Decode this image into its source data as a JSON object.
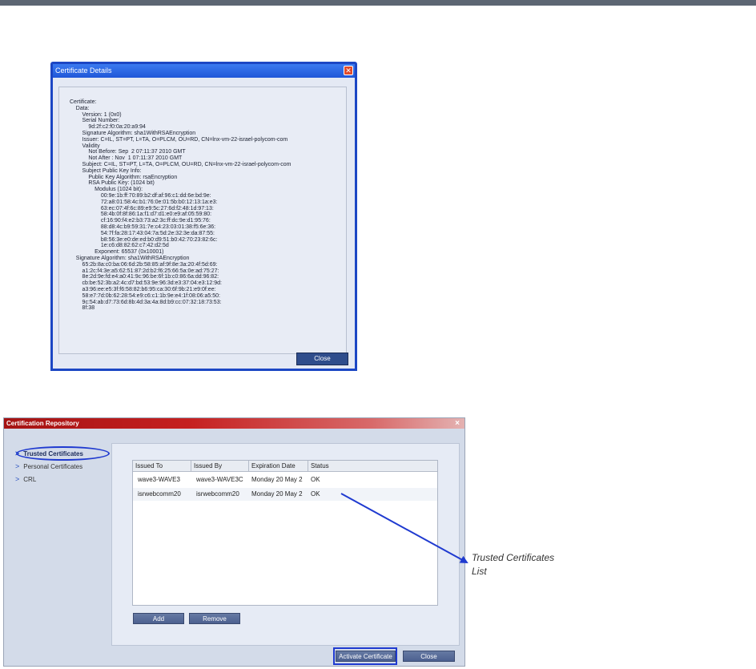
{
  "cert_details": {
    "title": "Certificate Details",
    "close_glyph": "✕",
    "lines": [
      "Certificate:",
      "    Data:",
      "        Version: 1 (0x0)",
      "        Serial Number:",
      "            9d:2f:c2:f0:0a:20:a9:94",
      "        Signature Algorithm: sha1WithRSAEncryption",
      "        Issuer: C=IL, ST=PT, L=TA, O=PLCM, OU=RD, CN=lnx-vm-22-israel-polycom-com",
      "        Validity",
      "            Not Before: Sep  2 07:11:37 2010 GMT",
      "            Not After : Nov  1 07:11:37 2010 GMT",
      "        Subject: C=IL, ST=PT, L=TA, O=PLCM, OU=RD, CN=lnx-vm-22-israel-polycom-com",
      "        Subject Public Key Info:",
      "            Public Key Algorithm: rsaEncryption",
      "            RSA Public Key: (1024 bit)",
      "                Modulus (1024 bit):",
      "                    00:9e:1b:ff:70:89:b2:df:af:96:c1:dd:6e:bd:9e:",
      "                    72:a8:01:58:4c:b1:76:0e:01:5b:b0:12:13:1a:e3:",
      "                    63:ec:07:4f:6c:89:e9:5c:27:6d:f2:48:1d:97:13:",
      "                    58:4b:0f:8f:86:1a:f1:d7:d1:e0:e9:af:05:59:80:",
      "                    cf:16:90:f4:e2:b3:73:a2:3c:ff:dc:9e:d1:95:76:",
      "                    88:d8:4c:b9:59:31:7e:c4:23:03:01:38:f5:6e:36:",
      "                    54:7f:fa:28:17:43:04:7a:5d:2e:32:3e:da:87:55:",
      "                    b8:56:3e:e0:de:ed:b0:d9:51:b0:42:70:23:82:6c:",
      "                    1e:c6:d8:82:62:c7:42:d2:5d",
      "                Exponent: 65537 (0x10001)",
      "    Signature Algorithm: sha1WithRSAEncryption",
      "        65:2b:8a:c0:ba:06:6d:2b:58:85:af:9f:8e:3a:20:4f:5d:69:",
      "        a1:2c:f4:3e:a5:62:51:87:2d:b2:f6:25:66:5a:0e:ad:75:27:",
      "        8e:2d:9e:fd:e4:a0:41:9c:96:be:6f:1b:c0:86:6a:dd:96:82:",
      "        cb:be:52:3b:a2:4c:d7:bd:53:9e:96:3d:e3:37:04:e3:12:9d:",
      "        a3:96:ee:e5:3f:f6:58:82:b6:95:ca:30:6f:9b:21:e9:0f:ee:",
      "        58:e7:7d:0b:62:28:54:e9:c6:c1:1b:9e:e4:1f:08:06:a5:50:",
      "        9c:54:ab:d7:73:6d:8b:4d:3a:4a:8d:b9:cc:07:32:18:73:53:",
      "        8f:38"
    ],
    "close_button": "Close"
  },
  "cert_repo": {
    "title": "Certification Repository",
    "close_glyph": "×",
    "nav": [
      {
        "label": "Trusted Certificates"
      },
      {
        "label": "Personal Certificates"
      },
      {
        "label": "CRL"
      }
    ],
    "table": {
      "columns": [
        "Issued To",
        "Issued By",
        "Expiration Date",
        "Status"
      ],
      "rows": [
        [
          "wave3-WAVE3",
          "wave3-WAVE3C",
          "Monday 20 May 2",
          "OK"
        ],
        [
          "isrwebcomm20",
          "isrwebcomm20",
          "Monday 20 May 2",
          "OK"
        ]
      ]
    },
    "buttons": {
      "add": "Add",
      "remove": "Remove",
      "activate": "Activate Certificate",
      "close": "Close"
    }
  },
  "callout": {
    "line1": "Trusted Certificates",
    "line2": "List"
  },
  "colors": {
    "annotation": "#1f3ad0",
    "repo_title_bar": "#b41a1a",
    "xp_title_bar": "#2a5fdc"
  }
}
